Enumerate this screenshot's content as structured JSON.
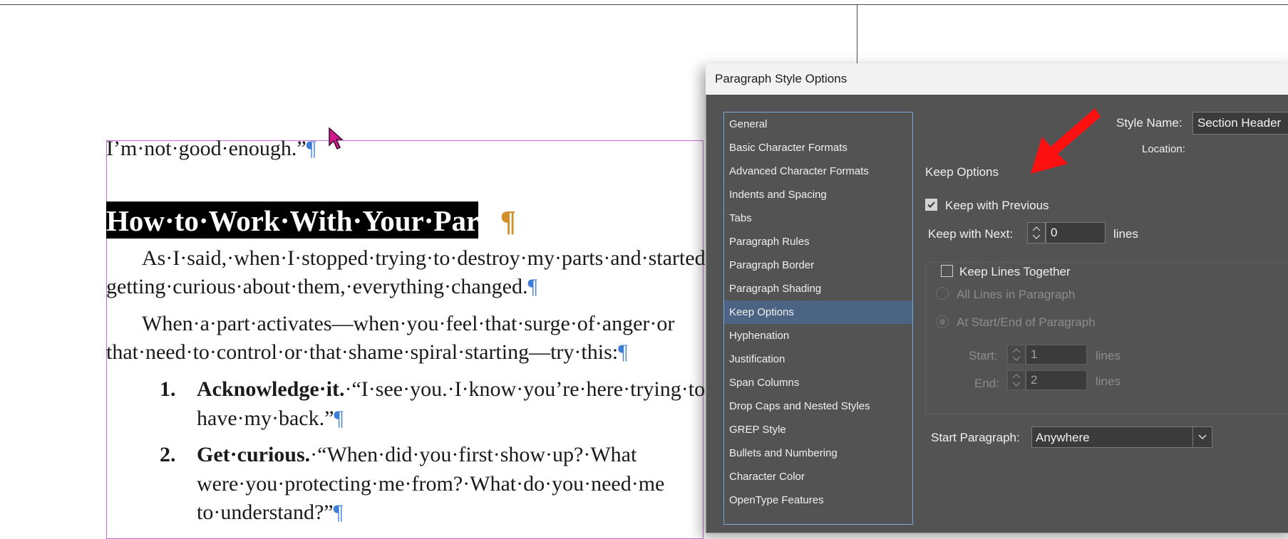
{
  "document": {
    "lines": {
      "p1": "I’m·not·good·enough.”",
      "heading": "How·to·Work·With·Your·Parts",
      "p2a": "As·I·said,·when·I·stopped·trying·to·destroy·my·parts·and·started",
      "p2b": "getting·curious·about·them,·everything·changed.",
      "p3a": "When·a·part·activates—when·you·feel·that·surge·of·anger·or",
      "p3b": "that·need·to·control·or·that·shame·spiral·starting—try·this:",
      "li1_num": "1.",
      "li1_bold": "Acknowledge·it.",
      "li1_rest": "·“I·see·you.·I·know·you’re·here·trying·to",
      "li1b": "have·my·back.”",
      "li2_num": "2.",
      "li2_bold": "Get·curious.",
      "li2_rest": "·“When·did·you·first·show·up?·What",
      "li2b": "were·you·protecting·me·from?·What·do·you·need·me",
      "li2c": "to·understand?”"
    },
    "pilcrow": "¶"
  },
  "dialog": {
    "title": "Paragraph Style Options",
    "categories": [
      "General",
      "Basic Character Formats",
      "Advanced Character Formats",
      "Indents and Spacing",
      "Tabs",
      "Paragraph Rules",
      "Paragraph Border",
      "Paragraph Shading",
      "Keep Options",
      "Hyphenation",
      "Justification",
      "Span Columns",
      "Drop Caps and Nested Styles",
      "GREP Style",
      "Bullets and Numbering",
      "Character Color",
      "OpenType Features"
    ],
    "selected_category": "Keep Options",
    "style_name_label": "Style Name:",
    "style_name_value": "Section Header",
    "location_label": "Location:",
    "section_title": "Keep Options",
    "keep_with_previous": {
      "label": "Keep with Previous",
      "checked": true
    },
    "keep_with_next": {
      "label": "Keep with Next:",
      "value": "0",
      "unit": "lines"
    },
    "keep_lines_together": {
      "label": "Keep Lines Together",
      "checked": false
    },
    "all_lines": "All Lines in Paragraph",
    "at_start_end": "At Start/End of Paragraph",
    "start": {
      "label": "Start:",
      "value": "1",
      "unit": "lines"
    },
    "end": {
      "label": "End:",
      "value": "2",
      "unit": "lines"
    },
    "start_paragraph": {
      "label": "Start Paragraph:",
      "value": "Anywhere"
    }
  },
  "colors": {
    "arrow": "#ff1010",
    "selection": "#4b6483",
    "pilcrow": "#3d7ed8",
    "frame": "#c86ad4"
  }
}
